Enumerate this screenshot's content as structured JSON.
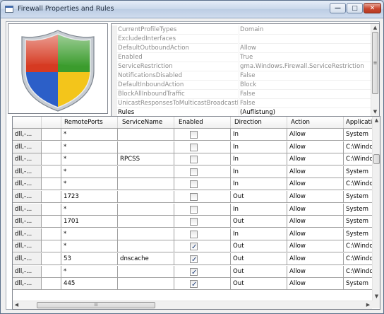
{
  "window": {
    "title": "Firewall Properties and Rules",
    "min_glyph": "—",
    "max_glyph": "□",
    "close_glyph": "✕"
  },
  "colors": {
    "shield_red": "#d63a22",
    "shield_green": "#3b9c2d",
    "shield_blue": "#2c5fc8",
    "shield_yellow": "#f3c51b",
    "shield_rim": "#9aa3ad"
  },
  "properties": [
    {
      "name": "CurrentProfileTypes",
      "value": "Domain"
    },
    {
      "name": "ExcludedInterfaces",
      "value": ""
    },
    {
      "name": "DefaultOutboundAction",
      "value": "Allow"
    },
    {
      "name": "Enabled",
      "value": "True"
    },
    {
      "name": "ServiceRestriction",
      "value": "gma.Windows.Firewall.ServiceRestriction"
    },
    {
      "name": "NotificationsDisabled",
      "value": "False"
    },
    {
      "name": "DefaultInboundAction",
      "value": "Block"
    },
    {
      "name": "BlockAllInboundTraffic",
      "value": "False"
    },
    {
      "name": "UnicastResponsesToMulticastBroadcastDis",
      "value": "False"
    },
    {
      "name": "Rules",
      "value": "(Auflistung)"
    }
  ],
  "grid": {
    "columns": [
      "",
      "RemotePorts",
      "ServiceName",
      "Enabled",
      "Direction",
      "Action",
      "Applicati"
    ],
    "rows": [
      {
        "c0": "dll,-...",
        "ports": "*",
        "service": "",
        "enabled": false,
        "direction": "In",
        "action": "Allow",
        "app": "System"
      },
      {
        "c0": "dll,-...",
        "ports": "*",
        "service": "",
        "enabled": false,
        "direction": "In",
        "action": "Allow",
        "app": "C:\\Windo"
      },
      {
        "c0": "dll,-...",
        "ports": "*",
        "service": "RPCSS",
        "enabled": false,
        "direction": "In",
        "action": "Allow",
        "app": "C:\\Windo"
      },
      {
        "c0": "dll,-...",
        "ports": "*",
        "service": "",
        "enabled": false,
        "direction": "In",
        "action": "Allow",
        "app": "System"
      },
      {
        "c0": "dll,-...",
        "ports": "*",
        "service": "",
        "enabled": false,
        "direction": "In",
        "action": "Allow",
        "app": "C:\\Windo"
      },
      {
        "c0": "dll,-...",
        "ports": "1723",
        "service": "",
        "enabled": false,
        "direction": "Out",
        "action": "Allow",
        "app": "System"
      },
      {
        "c0": "dll,-...",
        "ports": "*",
        "service": "",
        "enabled": false,
        "direction": "In",
        "action": "Allow",
        "app": "System"
      },
      {
        "c0": "dll,-...",
        "ports": "1701",
        "service": "",
        "enabled": false,
        "direction": "Out",
        "action": "Allow",
        "app": "System"
      },
      {
        "c0": "dll,-...",
        "ports": "*",
        "service": "",
        "enabled": false,
        "direction": "In",
        "action": "Allow",
        "app": "System"
      },
      {
        "c0": "dll,-...",
        "ports": "*",
        "service": "",
        "enabled": true,
        "direction": "Out",
        "action": "Allow",
        "app": "C:\\Windo"
      },
      {
        "c0": "dll,-...",
        "ports": "53",
        "service": "dnscache",
        "enabled": true,
        "direction": "Out",
        "action": "Allow",
        "app": "C:\\Windo"
      },
      {
        "c0": "dll,-...",
        "ports": "*",
        "service": "",
        "enabled": true,
        "direction": "Out",
        "action": "Allow",
        "app": "C:\\Windo"
      },
      {
        "c0": "dll,-...",
        "ports": "445",
        "service": "",
        "enabled": true,
        "direction": "Out",
        "action": "Allow",
        "app": "System"
      }
    ],
    "hscroll_grip": "III",
    "icons": {
      "up": "▲",
      "down": "▼",
      "left": "◀",
      "right": "▶",
      "grip": "≡"
    }
  }
}
